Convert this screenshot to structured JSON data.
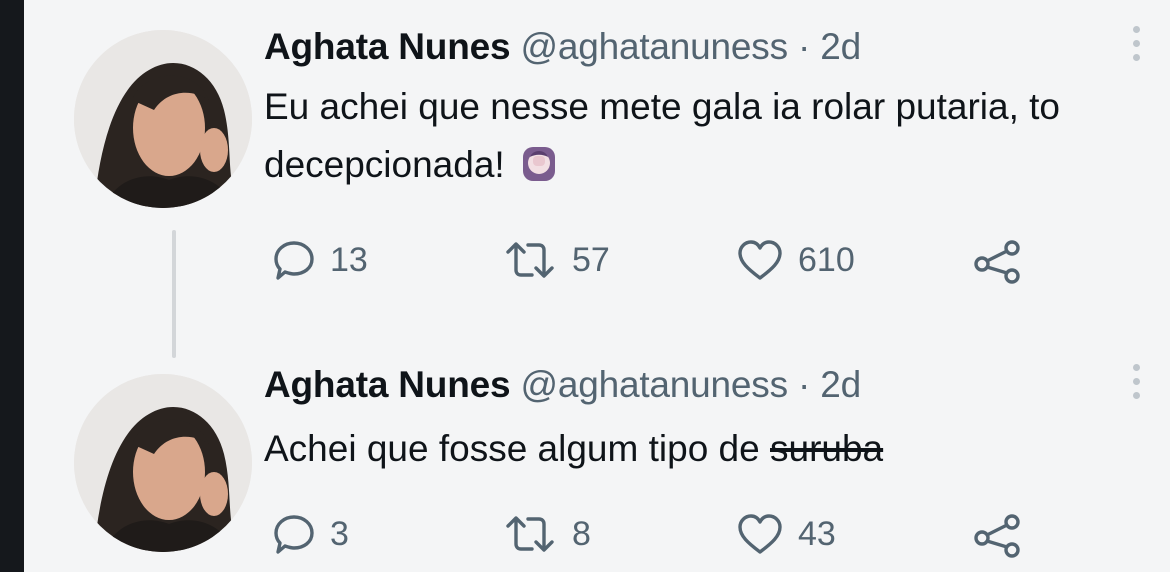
{
  "tweets": [
    {
      "author": "Aghata Nunes",
      "handle": "@aghatanuness",
      "separator": "·",
      "time": "2d",
      "text_before": "Eu achei que nesse mete gala ia rolar putaria, to decepcionada!",
      "text_strike": "",
      "emoji": "woman-facepalming-icon",
      "replies": "13",
      "retweets": "57",
      "likes": "610"
    },
    {
      "author": "Aghata Nunes",
      "handle": "@aghatanuness",
      "separator": "·",
      "time": "2d",
      "text_before": "Achei que fosse algum tipo de ",
      "text_strike": "suruba",
      "replies": "3",
      "retweets": "8",
      "likes": "43"
    }
  ],
  "icons": {
    "reply": "reply-icon",
    "retweet": "retweet-icon",
    "like": "heart-icon",
    "share": "share-icon",
    "more": "more-options-icon"
  },
  "colors": {
    "background": "#f4f5f6",
    "text": "#0f1419",
    "secondary": "#536471"
  }
}
